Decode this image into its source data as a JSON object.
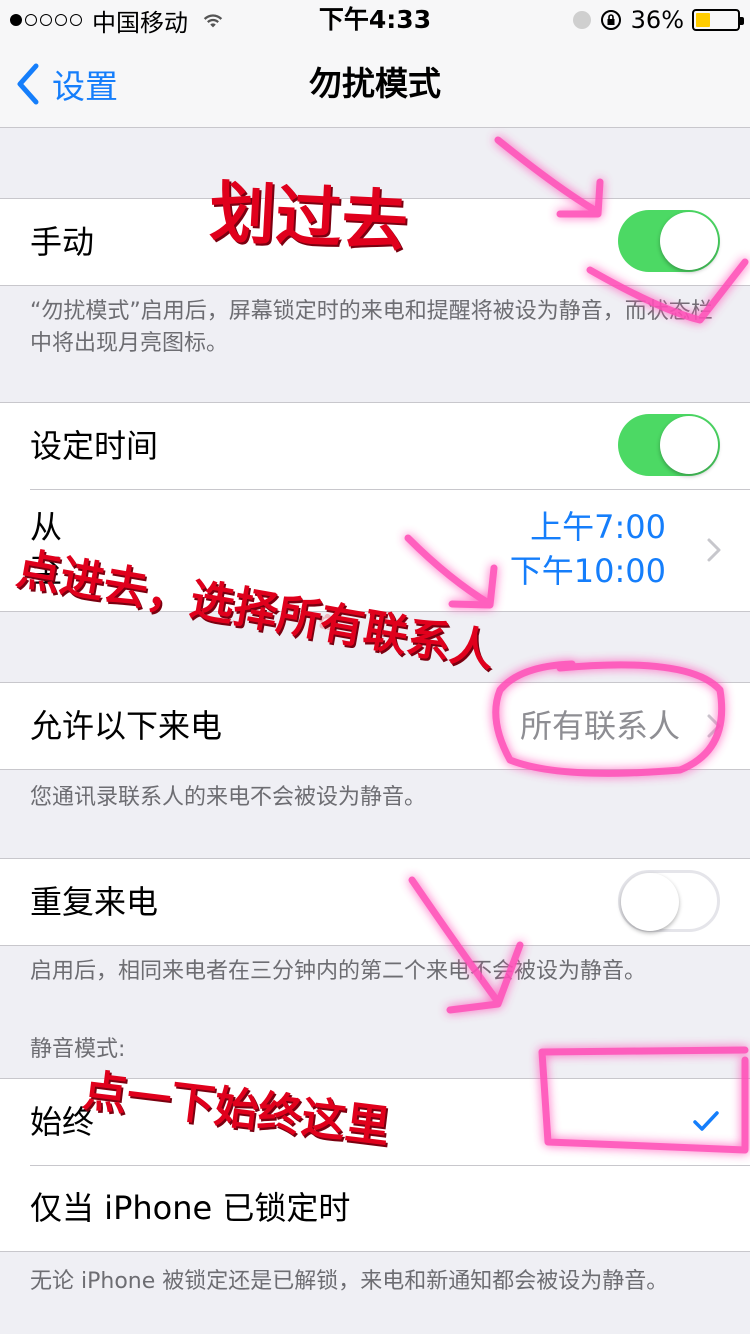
{
  "status_bar": {
    "carrier": "中国移动",
    "time": "下午4:33",
    "battery_percent": "36%",
    "battery_level": 0.36,
    "battery_color": "#ffcc00"
  },
  "nav": {
    "back_label": "设置",
    "title": "勿扰模式"
  },
  "manual": {
    "label": "手动",
    "on": true,
    "footer": "“勿扰模式”启用后，屏幕锁定时的来电和提醒将被设为静音，而状态栏中将出现月亮图标。"
  },
  "scheduled": {
    "label": "设定时间",
    "on": true,
    "from_label": "从",
    "to_label": "至",
    "from_time": "上午7:00",
    "to_time": "下午10:00"
  },
  "allow_calls": {
    "label": "允许以下来电",
    "value": "所有联系人",
    "footer": "您通讯录联系人的来电不会被设为静音。"
  },
  "repeated_calls": {
    "label": "重复来电",
    "on": false,
    "footer": "启用后，相同来电者在三分钟内的第二个来电不会被设为静音。"
  },
  "silence": {
    "header": "静音模式:",
    "options": [
      {
        "label": "始终",
        "selected": true
      },
      {
        "label": "仅当 iPhone 已锁定时",
        "selected": false
      }
    ],
    "footer": "无论 iPhone 被锁定还是已解锁，来电和新通知都会被设为静音。"
  },
  "annotations": {
    "swipe": "划过去",
    "tap_select": "点进去，选择所有联系人",
    "tap_always": "点一下始终这里"
  },
  "colors": {
    "accent_blue": "#157efb",
    "toggle_green": "#4cd964",
    "annotation_red": "#e0001c",
    "highlight_pink": "#ff4fb8"
  }
}
